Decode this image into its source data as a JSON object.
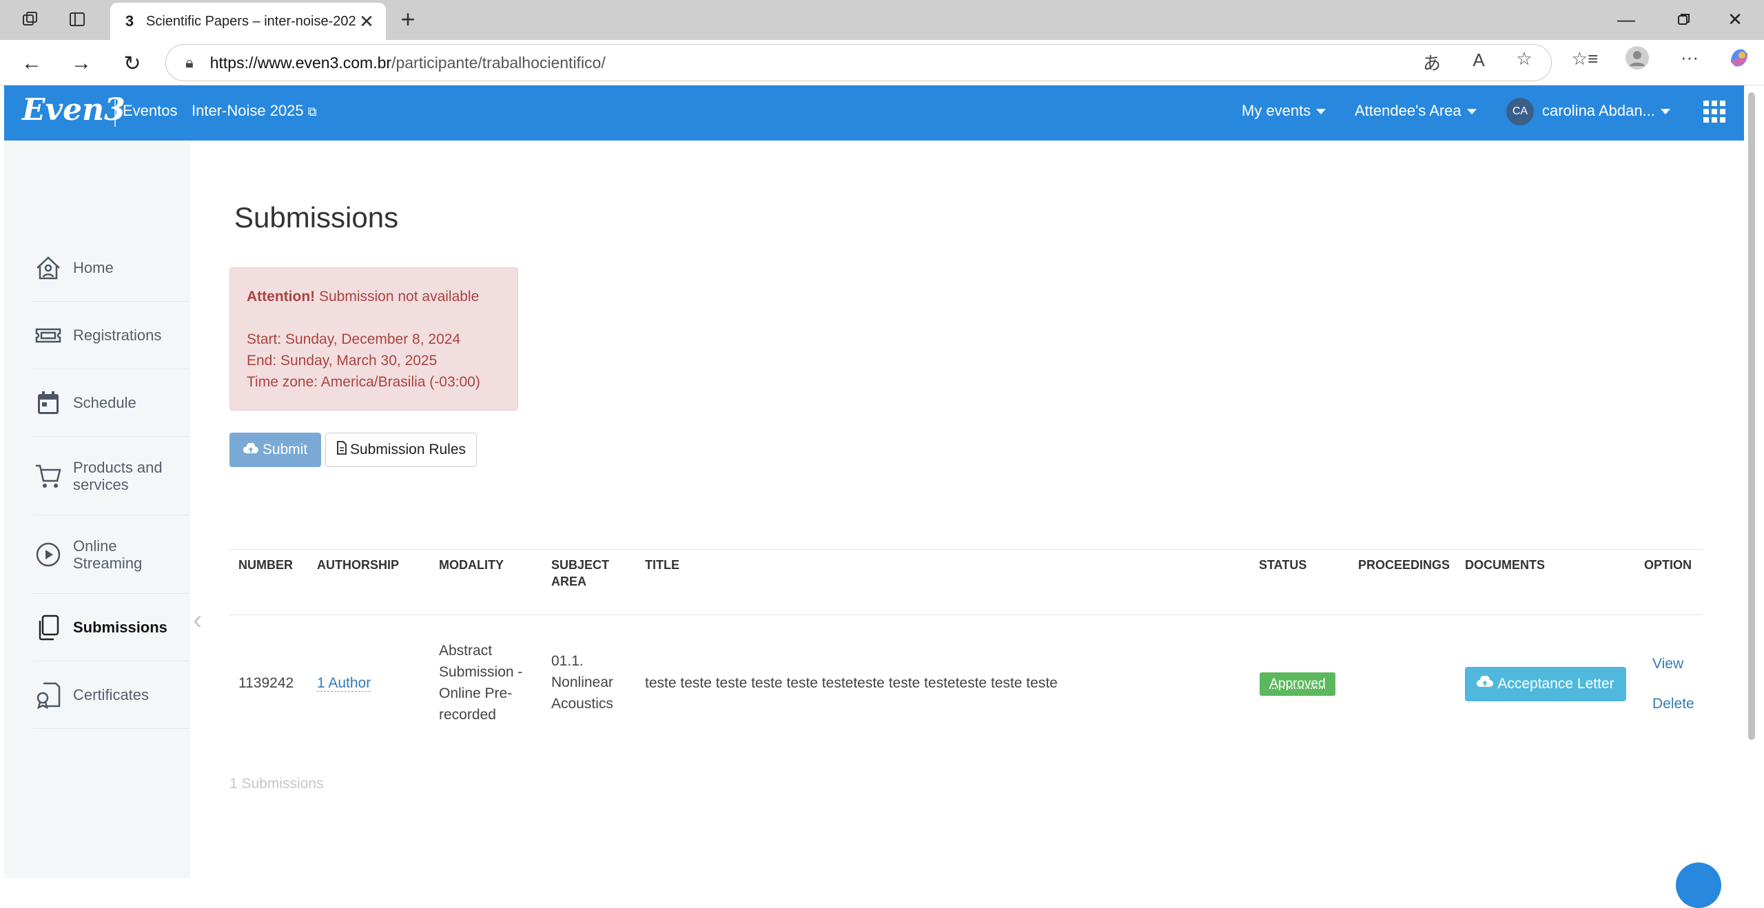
{
  "browser": {
    "tab_favicon": "3",
    "tab_title": "Scientific Papers – inter-noise-202",
    "url_domain": "https://www.even3.com.br",
    "url_path": "/participante/trabalhocientifico/"
  },
  "header": {
    "logo": "Even3",
    "eventos": "Eventos",
    "event_name": "Inter-Noise 2025",
    "my_events": "My events",
    "attendee_area": "Attendee's Area",
    "avatar_initials": "CA",
    "user_name": "carolina Abdan..."
  },
  "sidebar": {
    "items": [
      {
        "label": "Home",
        "icon": "home-icon"
      },
      {
        "label": "Registrations",
        "icon": "ticket-icon"
      },
      {
        "label": "Schedule",
        "icon": "calendar-icon"
      },
      {
        "label": "Products and services",
        "icon": "cart-icon"
      },
      {
        "label": "Online Streaming",
        "icon": "play-icon"
      },
      {
        "label": "Submissions",
        "icon": "copy-icon",
        "active": true
      },
      {
        "label": "Certificates",
        "icon": "certificate-icon"
      }
    ]
  },
  "main": {
    "title": "Submissions",
    "alert": {
      "strong": "Attention!",
      "message": " Submission not available",
      "start": "Start: Sunday, December 8, 2024",
      "end": "End: Sunday, March 30, 2025",
      "timezone": "Time zone: America/Brasilia (-03:00)"
    },
    "submit_label": "Submit",
    "rules_label": "Submission Rules",
    "table": {
      "headers": {
        "number": "NUMBER",
        "authorship": "AUTHORSHIP",
        "modality": "MODALITY",
        "subject_1": "SUBJECT",
        "subject_2": "AREA",
        "title": "TITLE",
        "status": "STATUS",
        "proceedings": "PROCEEDINGS",
        "documents": "DOCUMENTS",
        "option": "OPTION"
      },
      "row": {
        "number": "1139242",
        "authorship": "1 Author",
        "modality_1": "Abstract",
        "modality_2": "Submission -",
        "modality_3": "Online Pre-",
        "modality_4": "recorded",
        "subject_1": "01.1.",
        "subject_2": "Nonlinear",
        "subject_3": "Acoustics",
        "title": "teste teste teste teste teste testeteste teste testeteste teste teste",
        "status": "Approved",
        "document_button": "Acceptance Letter",
        "view": "View",
        "delete": "Delete"
      }
    },
    "count": "1 Submissions"
  },
  "colors": {
    "header_blue": "#2788dd",
    "alert_bg": "#f2dede",
    "alert_text": "#a94442",
    "approved_green": "#5cb85c",
    "letter_button": "#4fb8dc"
  }
}
